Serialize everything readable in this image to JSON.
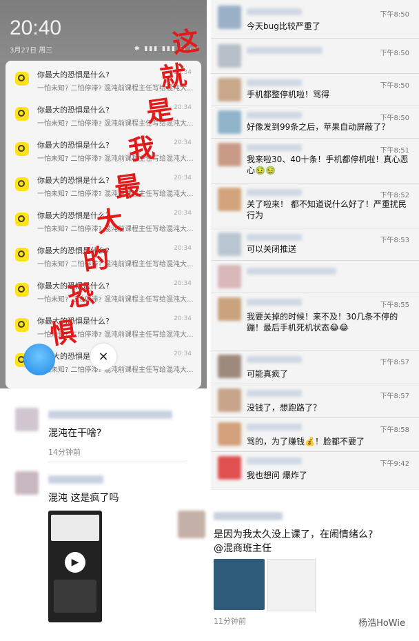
{
  "phone": {
    "clock": "20:40",
    "date": "3月27日 周三",
    "notifications": [
      {
        "title": "你最大的恐惧是什么?",
        "time": "20:34",
        "body": "一怕未知? 二怕停滞? 混沌前课程主任写给混沌大..."
      },
      {
        "title": "你最大的恐惧是什么?",
        "time": "20:34",
        "body": "一怕未知? 二怕停滞? 混沌前课程主任写给混沌大..."
      },
      {
        "title": "你最大的恐惧是什么?",
        "time": "20:34",
        "body": "一怕未知? 二怕停滞? 混沌前课程主任写给混沌大..."
      },
      {
        "title": "你最大的恐惧是什么?",
        "time": "20:34",
        "body": "一怕未知? 二怕停滞? 混沌前课程主任写给混沌大..."
      },
      {
        "title": "你最大的恐惧是什么?",
        "time": "20:34",
        "body": "一怕未知? 二怕停滞? 混沌前课程主任写给混沌大..."
      },
      {
        "title": "你最大的恐惧是什么?",
        "time": "20:34",
        "body": "一怕未知? 二怕停滞? 混沌前课程主任写给混沌大..."
      },
      {
        "title": "你最大的恐惧是什么?",
        "time": "20:34",
        "body": "一怕未知? 二怕停滞? 混沌前课程主任写给混沌大..."
      },
      {
        "title": "你最大的恐惧是什么?",
        "time": "20:34",
        "body": "一怕未知? 二怕停滞? 混沌前课程主任写给混沌大..."
      },
      {
        "title": "你最大的恐惧是什么?",
        "time": "20:34",
        "body": "一怕未知? 二怕停滞? 混沌前课程主任写给混沌大..."
      }
    ],
    "overlay_chars": [
      "这",
      "就",
      "是",
      "我",
      "最",
      "大",
      "的",
      "恐",
      "惧"
    ],
    "close_icon": "×"
  },
  "chat": {
    "messages": [
      {
        "time": "下午8:50",
        "text": "今天bug比较严重了"
      },
      {
        "time": "下午8:50",
        "text": ""
      },
      {
        "time": "下午8:50",
        "text": "手机都整停机啦！骂得"
      },
      {
        "time": "下午8:50",
        "text": "好像发到99条之后，苹果自动屏蔽了？"
      },
      {
        "time": "下午8:51",
        "text": "我来啦30、40十条！手机都停机啦！真心恶心🤢🤢"
      },
      {
        "time": "下午8:52",
        "text": "关了啦来！       都不知道说什么好了！严重扰民行为"
      },
      {
        "time": "下午8:53",
        "text": "                     可以关闭推送"
      },
      {
        "time": "",
        "text": ""
      },
      {
        "time": "下午8:55",
        "text": "               我要关掉的时候！来不及！30几条不停的蹦！最后手机死机状态😂😂"
      },
      {
        "time": "下午8:57",
        "text": "可能真疯了"
      },
      {
        "time": "下午8:57",
        "text": "没钱了，想跑路了？"
      },
      {
        "time": "下午8:58",
        "text": "骂的，为了赚钱💰！脸都不要了"
      },
      {
        "time": "下午9:42",
        "text": "我也想问 爆炸了"
      }
    ]
  },
  "comments_left": [
    {
      "text": "混沌在干啥?",
      "time": "14分钟前"
    },
    {
      "text": "混沌 这是疯了吗",
      "time": ""
    }
  ],
  "comment_right": {
    "text": "是因为我太久没上课了，在闹情绪么?",
    "mention": "@混商班主任",
    "time": "11分钟前"
  },
  "watermark": "杨浩HoWie"
}
